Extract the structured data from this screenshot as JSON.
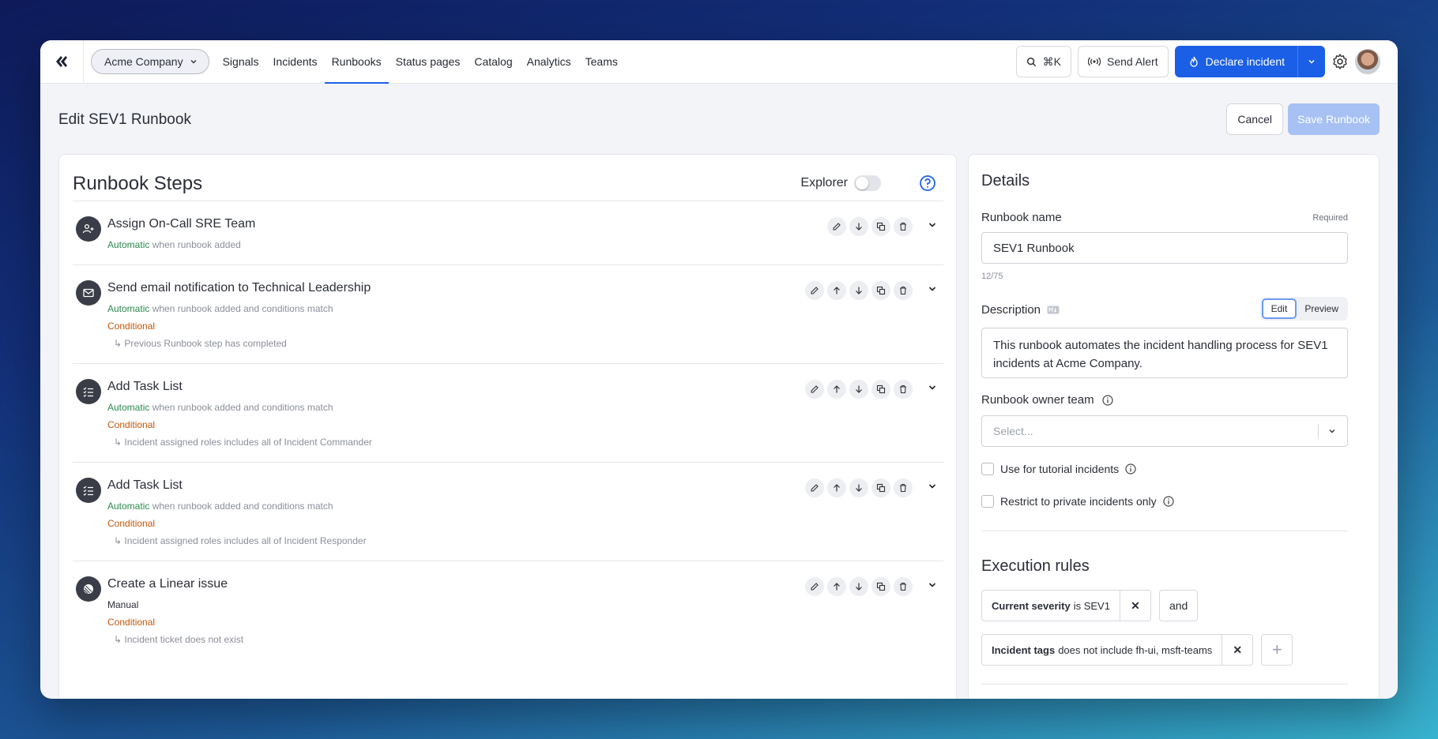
{
  "nav": {
    "company": "Acme Company",
    "links": [
      "Signals",
      "Incidents",
      "Runbooks",
      "Status pages",
      "Catalog",
      "Analytics",
      "Teams"
    ],
    "active_link": "Runbooks",
    "search_shortcut": "⌘K",
    "send_alert": "Send Alert",
    "declare": "Declare incident"
  },
  "header": {
    "title": "Edit SEV1 Runbook",
    "cancel": "Cancel",
    "save": "Save Runbook"
  },
  "steps_panel": {
    "title": "Runbook Steps",
    "explorer": "Explorer",
    "steps": [
      {
        "icon": "assign-team-icon",
        "title": "Assign On-Call SRE Team",
        "mode": "Automatic",
        "trigger": "when runbook added",
        "conditional": "",
        "condition_detail": ""
      },
      {
        "icon": "email-icon",
        "title": "Send email notification to Technical Leadership",
        "mode": "Automatic",
        "trigger": "when runbook added and conditions match",
        "conditional": "Conditional",
        "condition_detail": "↳ Previous Runbook step has completed"
      },
      {
        "icon": "task-list-icon",
        "title": "Add Task List",
        "mode": "Automatic",
        "trigger": "when runbook added and conditions match",
        "conditional": "Conditional",
        "condition_detail": "↳ Incident assigned roles includes all of Incident Commander"
      },
      {
        "icon": "task-list-icon",
        "title": "Add Task List",
        "mode": "Automatic",
        "trigger": "when runbook added and conditions match",
        "conditional": "Conditional",
        "condition_detail": "↳ Incident assigned roles includes all of Incident Responder"
      },
      {
        "icon": "linear-icon",
        "title": "Create a Linear issue",
        "mode": "Manual",
        "trigger": "",
        "conditional": "Conditional",
        "condition_detail": "↳ Incident ticket does not exist"
      }
    ]
  },
  "details": {
    "title": "Details",
    "name_label": "Runbook name",
    "required": "Required",
    "name_value": "SEV1 Runbook",
    "name_counter": "12/75",
    "description_label": "Description",
    "edit_tab": "Edit",
    "preview_tab": "Preview",
    "description_value": "This runbook automates the incident handling process for SEV1 incidents at Acme Company.",
    "owner_label": "Runbook owner team",
    "owner_placeholder": "Select...",
    "tutorial_label": "Use for tutorial incidents",
    "private_label": "Restrict to private incidents only"
  },
  "execution": {
    "title": "Execution rules",
    "rule1_field": "Current severity",
    "rule1_rest": "is SEV1",
    "and_label": "and",
    "rule2_field": "Incident tags",
    "rule2_rest": "does not include fh-ui, msft-teams"
  },
  "colors": {
    "primary": "#1b5fe6",
    "automatic": "#2b8a4d",
    "conditional": "#c2570b"
  }
}
